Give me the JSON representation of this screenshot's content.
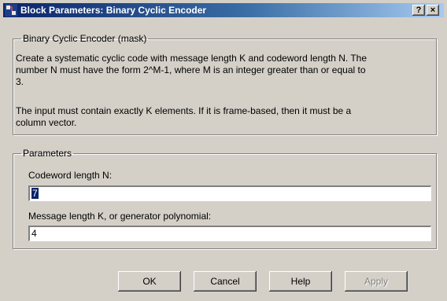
{
  "window": {
    "title": "Block Parameters: Binary Cyclic Encoder",
    "help_label": "?",
    "close_label": "×"
  },
  "description": {
    "group_label": "Binary Cyclic Encoder (mask)",
    "paragraph1": "Create a systematic cyclic code with message length K and codeword length N.  The\nnumber N must have the form 2^M-1, where M is an integer greater than or equal to\n3.",
    "paragraph2": "The input must contain exactly K elements.  If it is frame-based, then it must be a\ncolumn vector."
  },
  "parameters": {
    "group_label": "Parameters",
    "codeword_label": "Codeword length N:",
    "codeword_value": "7",
    "message_label": "Message length K, or generator polynomial:",
    "message_value": "4"
  },
  "buttons": {
    "ok": "OK",
    "cancel": "Cancel",
    "help": "Help",
    "apply": "Apply"
  },
  "colors": {
    "title_bar": "#0a246a",
    "dialog_face": "#d4d0c8",
    "selection": "#0a246a"
  }
}
